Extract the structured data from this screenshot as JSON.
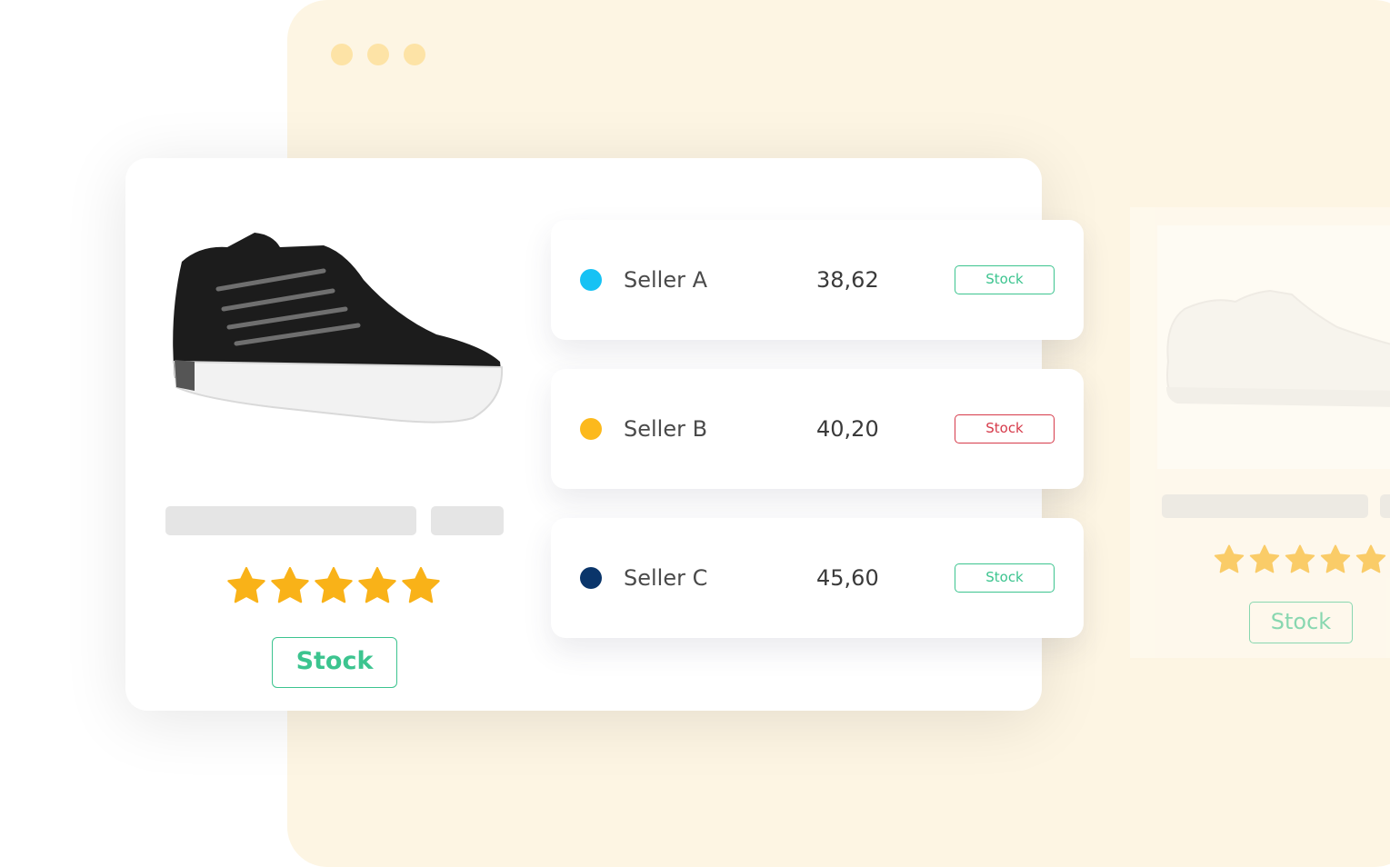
{
  "colors": {
    "accent_green": "#3cc48f",
    "alert_red": "#d63a4a",
    "star_yellow": "#f9b218",
    "browser_bg": "#fdf5e3",
    "seller_a_dot": "#16c2f4",
    "seller_b_dot": "#fcb91c",
    "seller_c_dot": "#0a356a"
  },
  "product": {
    "image_icon": "black-high-top-sneaker",
    "rating_stars": 5,
    "stock_label": "Stock"
  },
  "sellers": [
    {
      "name": "Seller A",
      "price": "38,62",
      "stock_label": "Stock",
      "stock_status": "in-stock",
      "dot_color": "#16c2f4"
    },
    {
      "name": "Seller B",
      "price": "40,20",
      "stock_label": "Stock",
      "stock_status": "out-of-stock",
      "dot_color": "#fcb91c"
    },
    {
      "name": "Seller C",
      "price": "45,60",
      "stock_label": "Stock",
      "stock_status": "in-stock",
      "dot_color": "#0a356a"
    }
  ],
  "side_product": {
    "image_icon": "white-low-top-sneaker",
    "rating_stars": 5,
    "stock_label": "Stock"
  }
}
